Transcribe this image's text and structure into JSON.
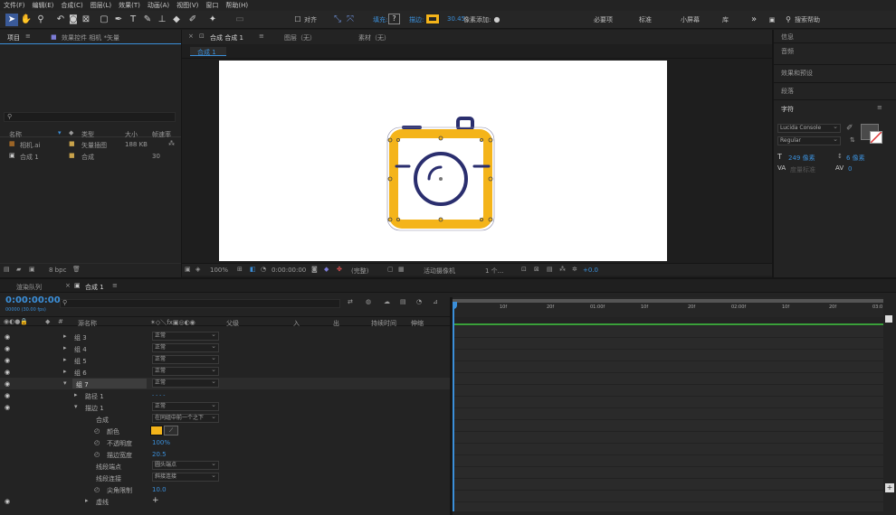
{
  "menu": [
    "文件(F)",
    "编辑(E)",
    "合成(C)",
    "图层(L)",
    "效果(T)",
    "动画(A)",
    "视图(V)",
    "窗口",
    "帮助(H)"
  ],
  "toolbar": {
    "align_label": "对齐",
    "fill_label": "填充:",
    "stroke_label": "描边:",
    "stroke_px": "30.45",
    "px_label": "像素添加:",
    "workspaces": [
      "必要项",
      "标准",
      "小屏幕",
      "库"
    ],
    "search_placeholder": "搜索帮助"
  },
  "project": {
    "tab": "项目",
    "effects_tab": "效果控件 相机 *矢量",
    "search_placeholder": "",
    "columns": {
      "name": "名称",
      "type": "类型",
      "size": "大小",
      "fps": "帧速率"
    },
    "items": [
      {
        "name": "相机.ai",
        "type": "矢量插图",
        "size": "188 KB",
        "fps": ""
      },
      {
        "name": "合成 1",
        "type": "合成",
        "size": "",
        "fps": "30"
      }
    ],
    "bpc": "8 bpc"
  },
  "comp_viewer": {
    "tab": "合成 合成 1",
    "layer_tab": "图层（无）",
    "footage_tab": "素材（无）",
    "breadcrumb": "合成 1",
    "zoom": "100%",
    "timecode": "0:00:00:00",
    "resolution": "(完整)",
    "camera": "活动摄像机",
    "views": "1 个...",
    "exposure": "+0.0"
  },
  "right_panel": {
    "items": [
      "信息",
      "音频",
      "效果和预设",
      "段落"
    ],
    "char_title": "字符",
    "font": "Lucida Console",
    "style": "Regular",
    "size": "249 像素",
    "leading": "6 像素",
    "kerning": "度量标准",
    "tracking": "0"
  },
  "timeline": {
    "render_tab": "渲染队列",
    "comp_tab": "合成 1",
    "timecode": "0:00:00:00",
    "fps_sub": "00000 (30.00 fps)",
    "col_source": "源名称",
    "col_mode": "模式",
    "col_parent": "父级",
    "col_in": "入",
    "col_out": "出",
    "col_duration": "持续时间",
    "col_stretch": "伸缩",
    "ruler": [
      "10f",
      "20f",
      "01:00f",
      "10f",
      "20f",
      "02:00f",
      "10f",
      "20f",
      "03:0"
    ],
    "layers": [
      {
        "name": "组 3",
        "mode": "正常"
      },
      {
        "name": "组 4",
        "mode": "正常"
      },
      {
        "name": "组 5",
        "mode": "正常"
      },
      {
        "name": "组 6",
        "mode": "正常"
      },
      {
        "name": "组 7",
        "mode": "正常"
      }
    ],
    "path_label": "路径 1",
    "stroke_label": "描边 1",
    "stroke_mode": "正常",
    "composite_label": "合成",
    "composite_value": "在同组中前一个之下",
    "color_label": "颜色",
    "opacity_label": "不透明度",
    "opacity_value": "100%",
    "width_label": "描边宽度",
    "width_value": "20.5",
    "cap_label": "线段端点",
    "cap_value": "圆头端点",
    "join_label": "线段连接",
    "join_value": "斜接连接",
    "miter_label": "尖角限制",
    "miter_value": "10.0",
    "dash_label": "虚线"
  },
  "colors": {
    "accent": "#3b8fd9",
    "camera_body": "#f4b41a",
    "camera_line": "#2a2e6e"
  }
}
